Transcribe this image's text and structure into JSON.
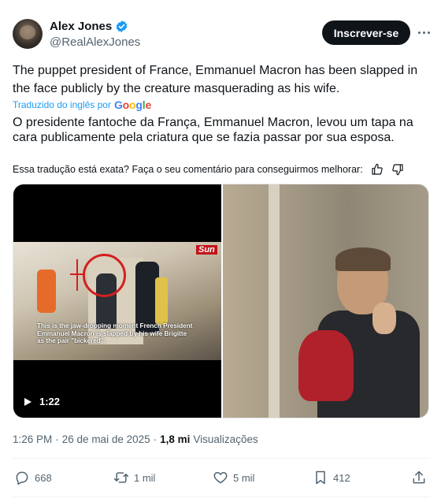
{
  "author": {
    "display_name": "Alex Jones",
    "handle": "@RealAlexJones",
    "verified_badge_color": "#1d9bf0"
  },
  "header": {
    "subscribe_label": "Inscrever-se",
    "more_icon": "more-dots-icon"
  },
  "tweet": {
    "text": "The puppet president of France, Emmanuel Macron has been slapped in the face publicly by the creature masquerading as his wife.",
    "translated_label": "Traduzido do inglês por",
    "translation_provider": "Google",
    "translation_text": "O presidente fantoche da França, Emmanuel Macron, levou um tapa na cara publicamente pela criatura que se fazia passar por sua esposa.",
    "feedback_prompt": "Essa tradução está exata? Faça o seu comentário para conseguirmos melhorar:"
  },
  "media": {
    "video": {
      "watermark": "Sun",
      "caption": "This is the jaw-dropping moment French President Emmanuel Macron is slapped by his wife Brigitte as the pair \"bickered\".",
      "duration": "1:22"
    }
  },
  "meta": {
    "time": "1:26 PM",
    "separator": "·",
    "date": "26 de mai de 2025",
    "views_count": "1,8 mi",
    "views_label": "Visualizações"
  },
  "actions": {
    "replies": "668",
    "reposts": "1 mil",
    "likes": "5 mil",
    "bookmarks": "412"
  },
  "colors": {
    "text_primary": "#0f1419",
    "text_secondary": "#536471",
    "accent": "#1d9bf0",
    "button_bg": "#0f1419"
  }
}
